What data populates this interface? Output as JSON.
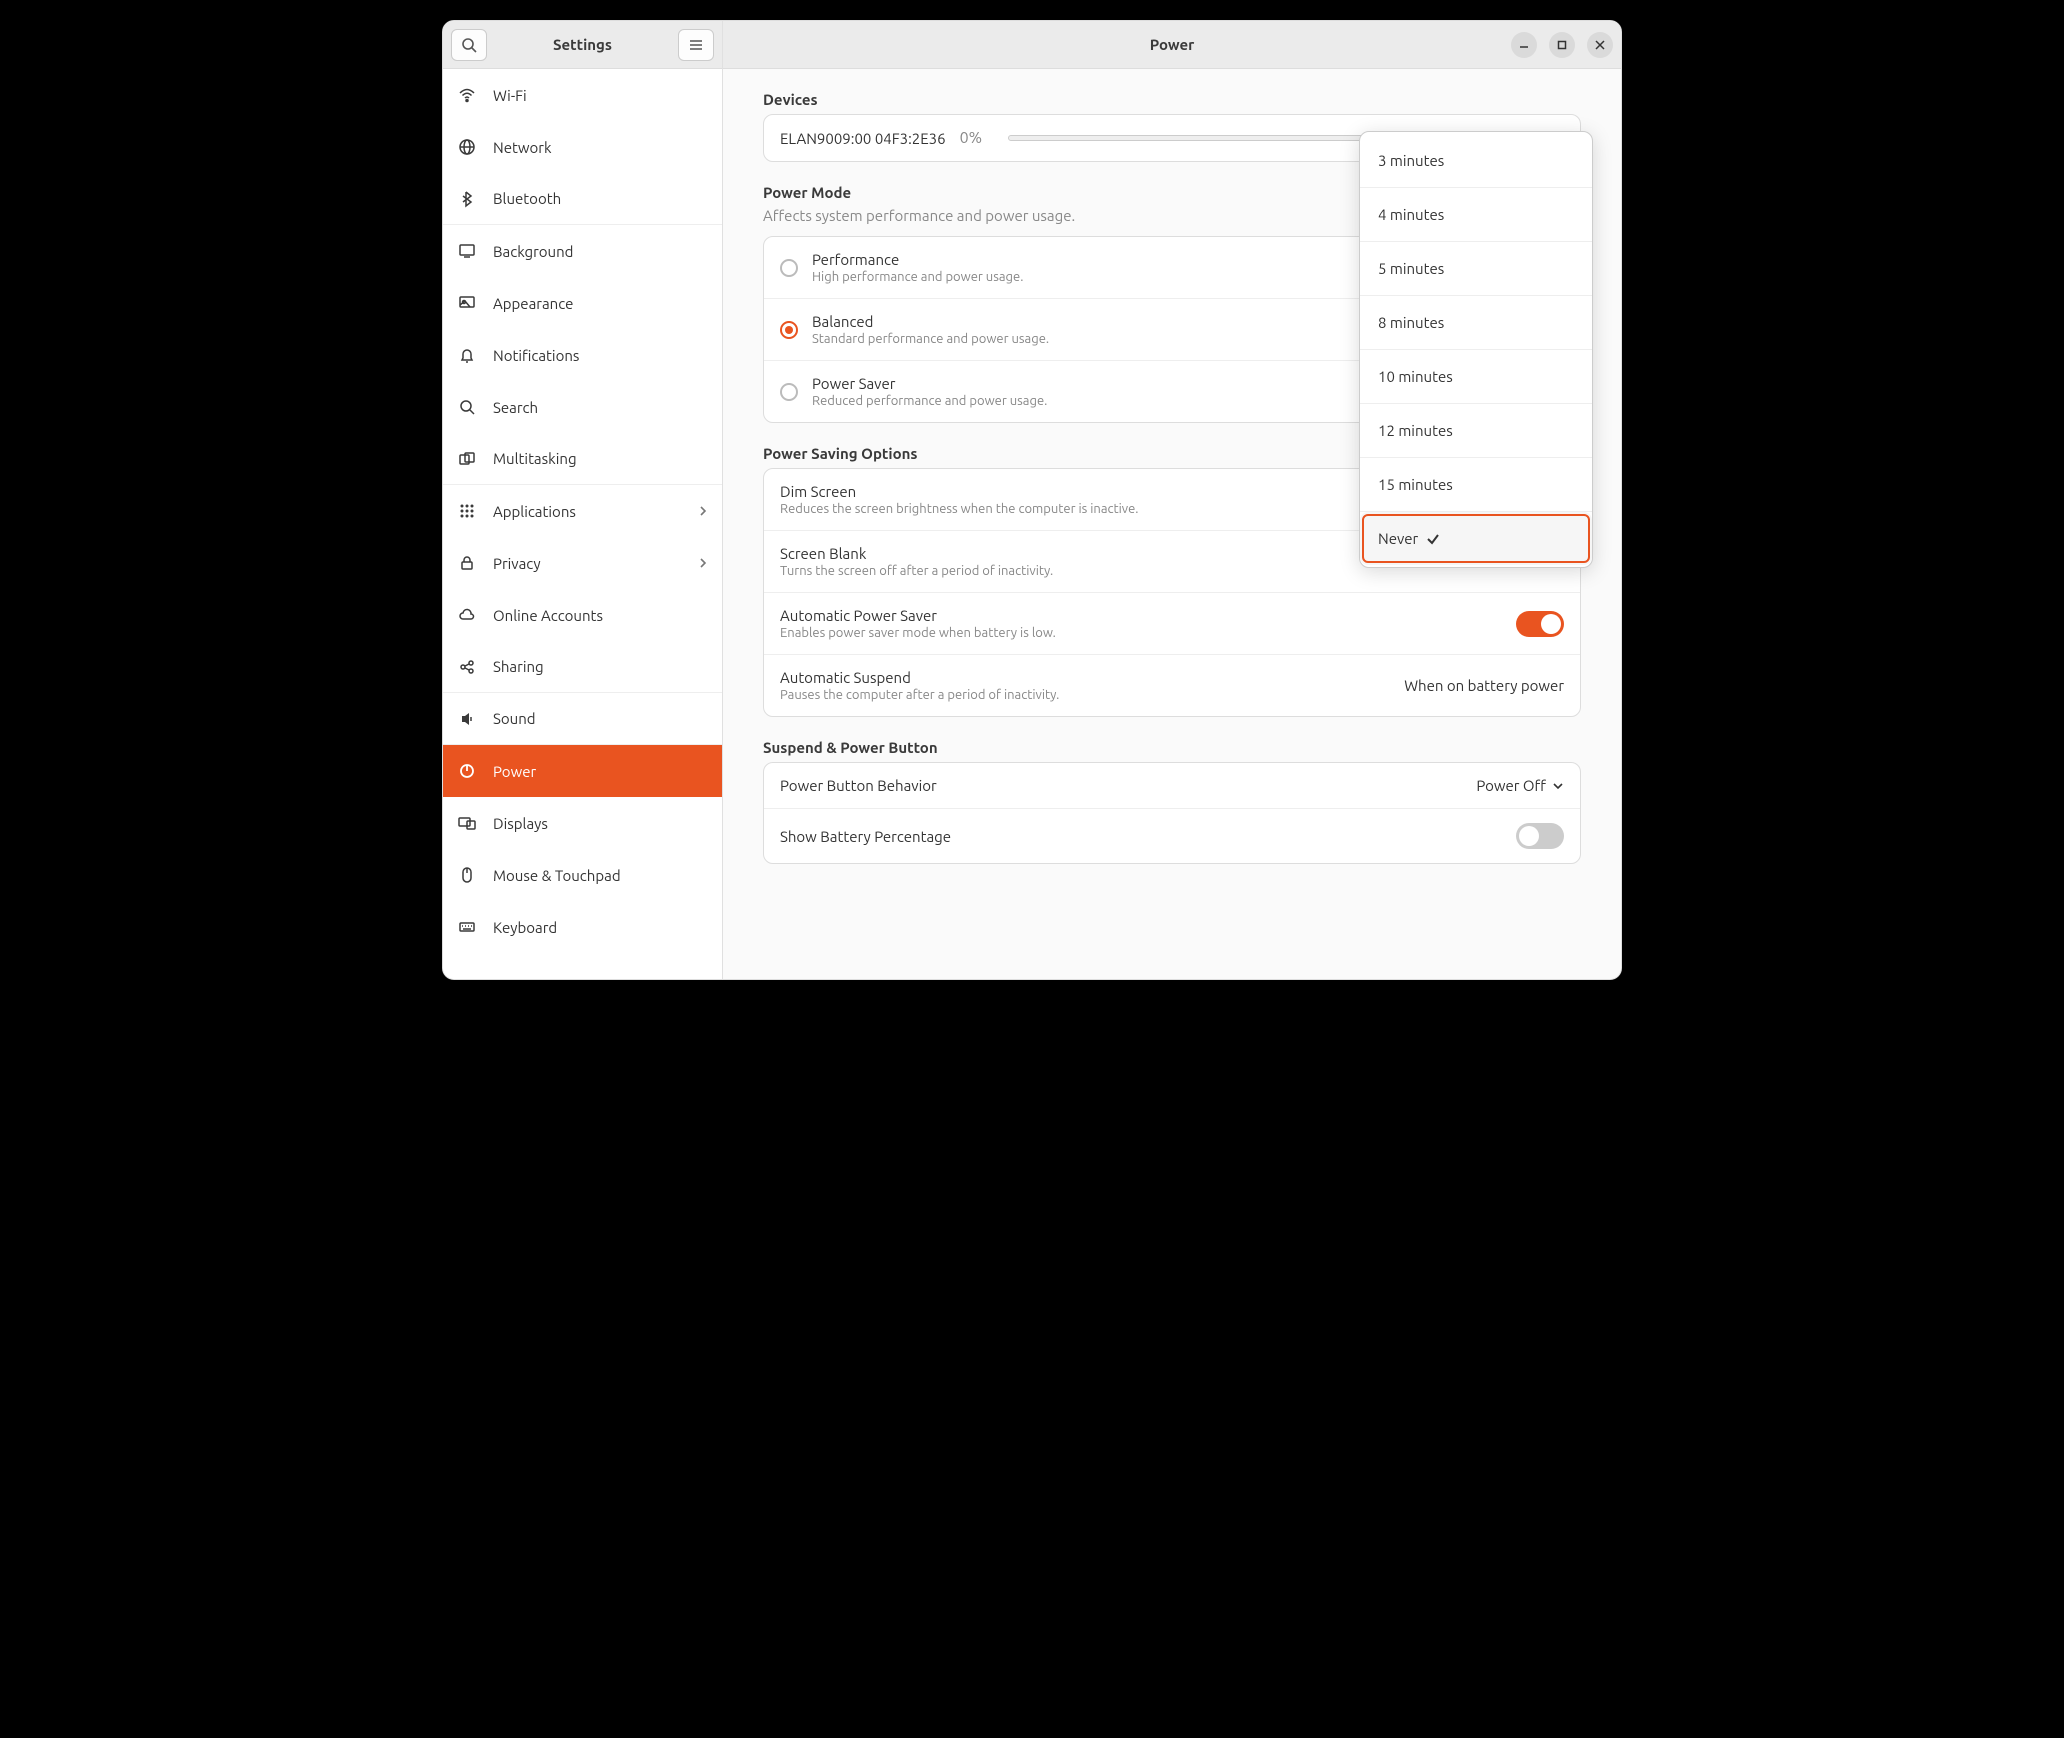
{
  "header": {
    "sidebar_title": "Settings",
    "main_title": "Power"
  },
  "sidebar": {
    "items": [
      {
        "label": "Wi-Fi",
        "icon": "wifi-icon"
      },
      {
        "label": "Network",
        "icon": "globe-icon"
      },
      {
        "label": "Bluetooth",
        "icon": "bluetooth-icon"
      },
      {
        "label": "Background",
        "icon": "display-icon"
      },
      {
        "label": "Appearance",
        "icon": "appearance-icon"
      },
      {
        "label": "Notifications",
        "icon": "bell-icon"
      },
      {
        "label": "Search",
        "icon": "search-icon"
      },
      {
        "label": "Multitasking",
        "icon": "multitask-icon"
      },
      {
        "label": "Applications",
        "icon": "apps-icon"
      },
      {
        "label": "Privacy",
        "icon": "lock-icon"
      },
      {
        "label": "Online Accounts",
        "icon": "cloud-icon"
      },
      {
        "label": "Sharing",
        "icon": "share-icon"
      },
      {
        "label": "Sound",
        "icon": "sound-icon"
      },
      {
        "label": "Power",
        "icon": "power-icon"
      },
      {
        "label": "Displays",
        "icon": "displays-icon"
      },
      {
        "label": "Mouse & Touchpad",
        "icon": "mouse-icon"
      },
      {
        "label": "Keyboard",
        "icon": "keyboard-icon"
      }
    ]
  },
  "devices": {
    "title": "Devices",
    "name": "ELAN9009:00 04F3:2E36",
    "pct": "0%"
  },
  "power_mode": {
    "title": "Power Mode",
    "subtitle": "Affects system performance and power usage.",
    "options": [
      {
        "title": "Performance",
        "desc": "High performance and power usage."
      },
      {
        "title": "Balanced",
        "desc": "Standard performance and power usage."
      },
      {
        "title": "Power Saver",
        "desc": "Reduced performance and power usage."
      }
    ]
  },
  "power_saving": {
    "title": "Power Saving Options",
    "dim_title": "Dim Screen",
    "dim_desc": "Reduces the screen brightness when the computer is inactive.",
    "blank_title": "Screen Blank",
    "blank_desc": "Turns the screen off after a period of inactivity.",
    "blank_value": "Never",
    "aps_title": "Automatic Power Saver",
    "aps_desc": "Enables power saver mode when battery is low.",
    "suspend_title": "Automatic Suspend",
    "suspend_desc": "Pauses the computer after a period of inactivity.",
    "suspend_value": "When on battery power"
  },
  "suspend_button": {
    "title": "Suspend & Power Button",
    "pbb_title": "Power Button Behavior",
    "pbb_value": "Power Off",
    "sbp_title": "Show Battery Percentage"
  },
  "popover": {
    "items": [
      "3 minutes",
      "4 minutes",
      "5 minutes",
      "8 minutes",
      "10 minutes",
      "12 minutes",
      "15 minutes",
      "Never"
    ],
    "selected": "Never"
  }
}
